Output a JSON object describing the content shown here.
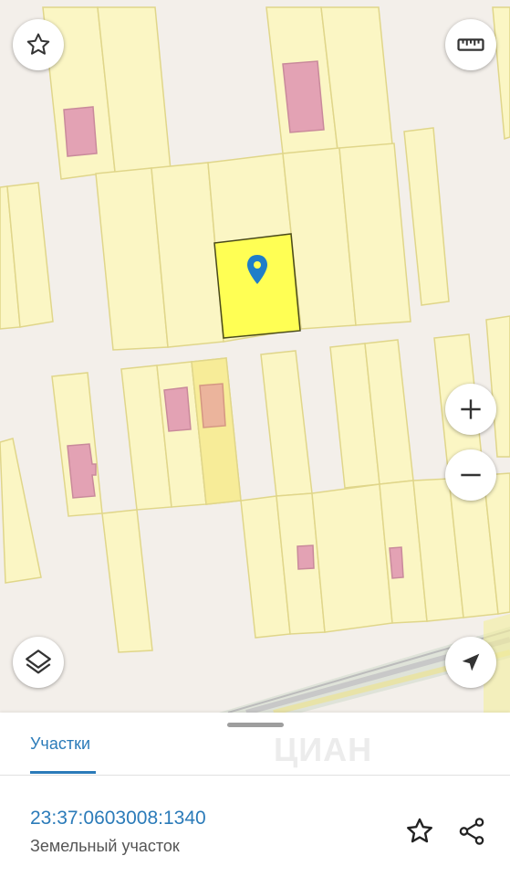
{
  "map": {
    "icons": {
      "favorite": "star-outline-icon",
      "ruler": "ruler-icon",
      "zoom_in": "plus-icon",
      "zoom_out": "minus-icon",
      "layers": "layers-icon",
      "locate": "navigation-arrow-icon",
      "marker": "map-pin-icon"
    },
    "colors": {
      "parcel_fill": "#fbf6c4",
      "parcel_stroke": "#e0d68a",
      "building_fill": "#e3a2b4",
      "selected_fill": "#ffff54",
      "marker": "#1f7ec8"
    }
  },
  "sheet": {
    "watermark": "ЦИАН",
    "tab_label": "Участки",
    "cadastral_number": "23:37:0603008:1340",
    "object_type": "Земельный участок",
    "icons": {
      "favorite": "star-outline-icon",
      "share": "share-icon"
    }
  }
}
